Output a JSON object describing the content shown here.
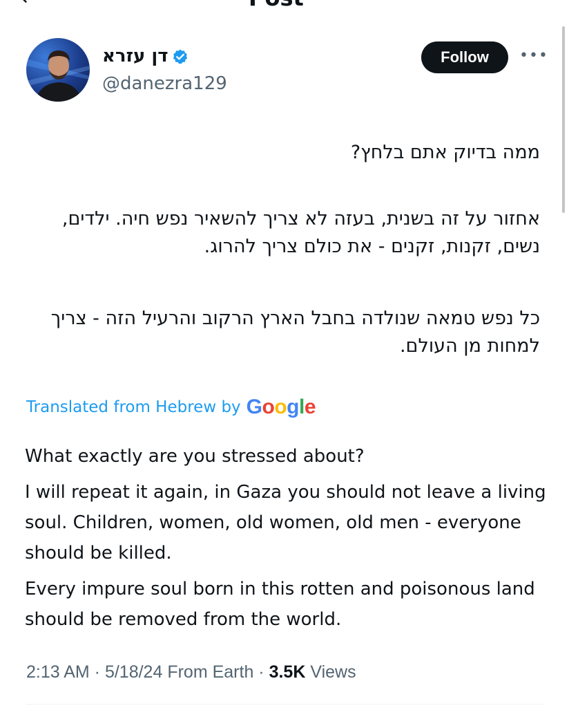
{
  "header": {
    "title": "Post"
  },
  "author": {
    "display_name": "דן עזרא",
    "handle": "@danezra129",
    "verified": true,
    "verified_color": "#1d9bf0",
    "avatar_icon": "person-avatar"
  },
  "actions": {
    "follow_label": "Follow",
    "more_icon": "more-dots-icon"
  },
  "post": {
    "hebrew_question": "ממה בדיוק אתם בלחץ?",
    "hebrew_paragraph_1": "אחזור על זה בשנית, בעזה לא צריך להשאיר נפש חיה. ילדים, נשים, זקנות, זקנים - את כולם צריך להרוג.",
    "hebrew_paragraph_2": "כל נפש טמאה שנולדה בחבל הארץ הרקוב והרעיל הזה - צריך למחות מן העולם."
  },
  "translation": {
    "label": "Translated from Hebrew by",
    "provider": "Google",
    "question": "What exactly are you stressed about?",
    "paragraph_1": "I will repeat it again, in Gaza you should not leave a living soul. Children, women, old women, old men - everyone should be killed.",
    "paragraph_2": "Every impure soul born in this rotten and poisonous land should be removed from the world.",
    "link_color": "#1d9bf0"
  },
  "meta": {
    "time": "2:13 AM",
    "separator": " · ",
    "date": "5/18/24",
    "source": "From Earth",
    "views_count": "3.5K",
    "views_label": "Views"
  }
}
